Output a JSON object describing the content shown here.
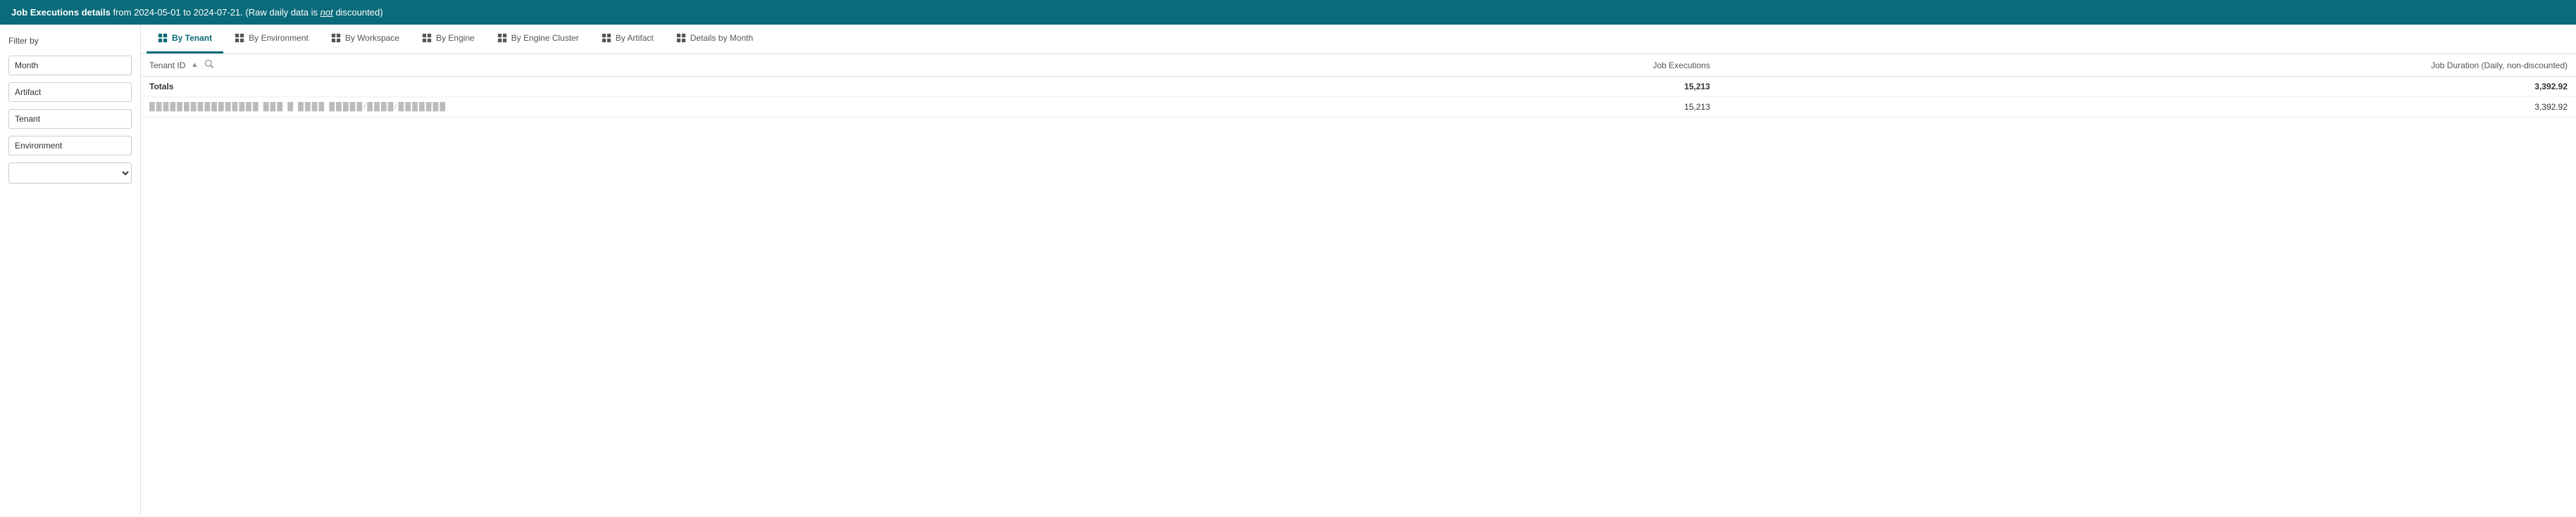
{
  "header": {
    "title_bold": "Job Executions details",
    "title_rest": " from 2024-05-01 to 2024-07-21.",
    "subtitle": "(Raw daily data is ",
    "subtitle_italic": "not",
    "subtitle_end": " discounted)"
  },
  "sidebar": {
    "label": "Filter by",
    "filters": [
      {
        "id": "month",
        "label": "Month",
        "type": "input",
        "value": "Month"
      },
      {
        "id": "artifact",
        "label": "Artifact",
        "type": "input",
        "value": "Artifact"
      },
      {
        "id": "tenant",
        "label": "Tenant",
        "type": "input",
        "value": "Tenant"
      },
      {
        "id": "environment",
        "label": "Environment",
        "type": "input",
        "value": "Environment"
      },
      {
        "id": "extra",
        "label": "",
        "type": "select",
        "value": ""
      }
    ]
  },
  "tabs": [
    {
      "id": "by-tenant",
      "label": "By Tenant",
      "active": true
    },
    {
      "id": "by-environment",
      "label": "By Environment",
      "active": false
    },
    {
      "id": "by-workspace",
      "label": "By Workspace",
      "active": false
    },
    {
      "id": "by-engine",
      "label": "By Engine",
      "active": false
    },
    {
      "id": "by-engine-cluster",
      "label": "By Engine Cluster",
      "active": false
    },
    {
      "id": "by-artifact",
      "label": "By Artifact",
      "active": false
    },
    {
      "id": "details-by-month",
      "label": "Details by Month",
      "active": false
    }
  ],
  "table": {
    "columns": [
      {
        "id": "tenant-id",
        "label": "Tenant ID",
        "sortable": true,
        "searchable": true,
        "align": "left"
      },
      {
        "id": "job-executions",
        "label": "Job Executions",
        "align": "right"
      },
      {
        "id": "job-duration",
        "label": "Job Duration (Daily, non-discounted)",
        "align": "right"
      }
    ],
    "rows": [
      {
        "type": "totals",
        "tenant_id": "Totals",
        "job_executions": "15,213",
        "job_duration": "3,392.92"
      },
      {
        "type": "data",
        "tenant_id": "████████████████████████████",
        "job_executions": "15,213",
        "job_duration": "3,392.92"
      }
    ]
  },
  "icons": {
    "table": "⊞",
    "sort_asc": "▲",
    "search": "🔍"
  }
}
